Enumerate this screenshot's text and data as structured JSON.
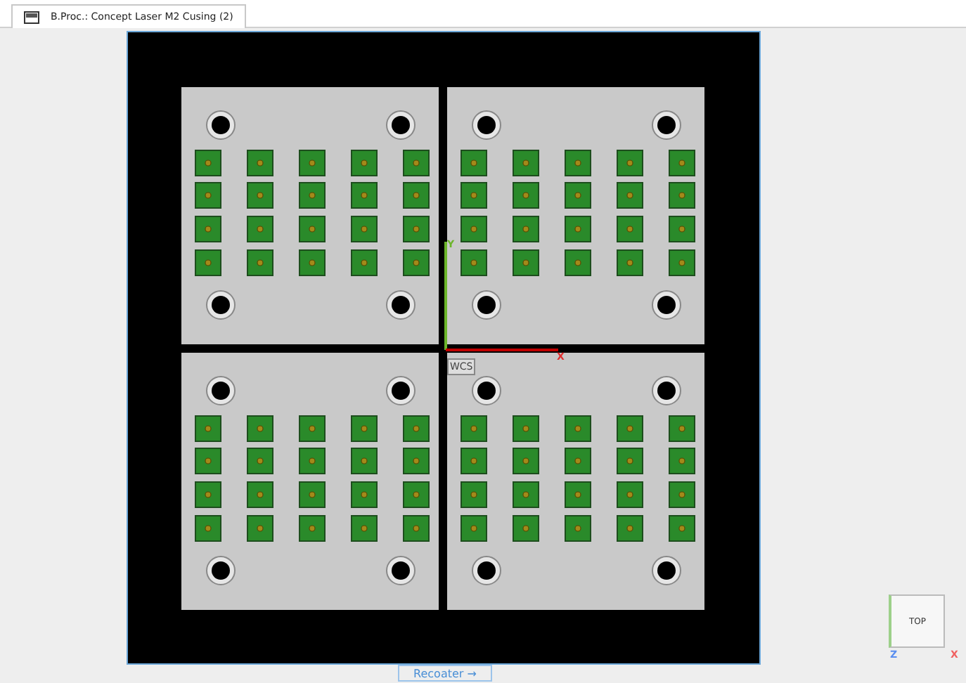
{
  "tab": {
    "title": "B.Proc.: Concept Laser M2 Cusing (2)",
    "selected": true
  },
  "axes": {
    "y_label": "Y",
    "x_label": "X",
    "wcs": "WCS"
  },
  "view_cube": {
    "face": "TOP",
    "z_label": "Z",
    "x_label": "X"
  },
  "recoater": {
    "label": "Recoater →"
  }
}
